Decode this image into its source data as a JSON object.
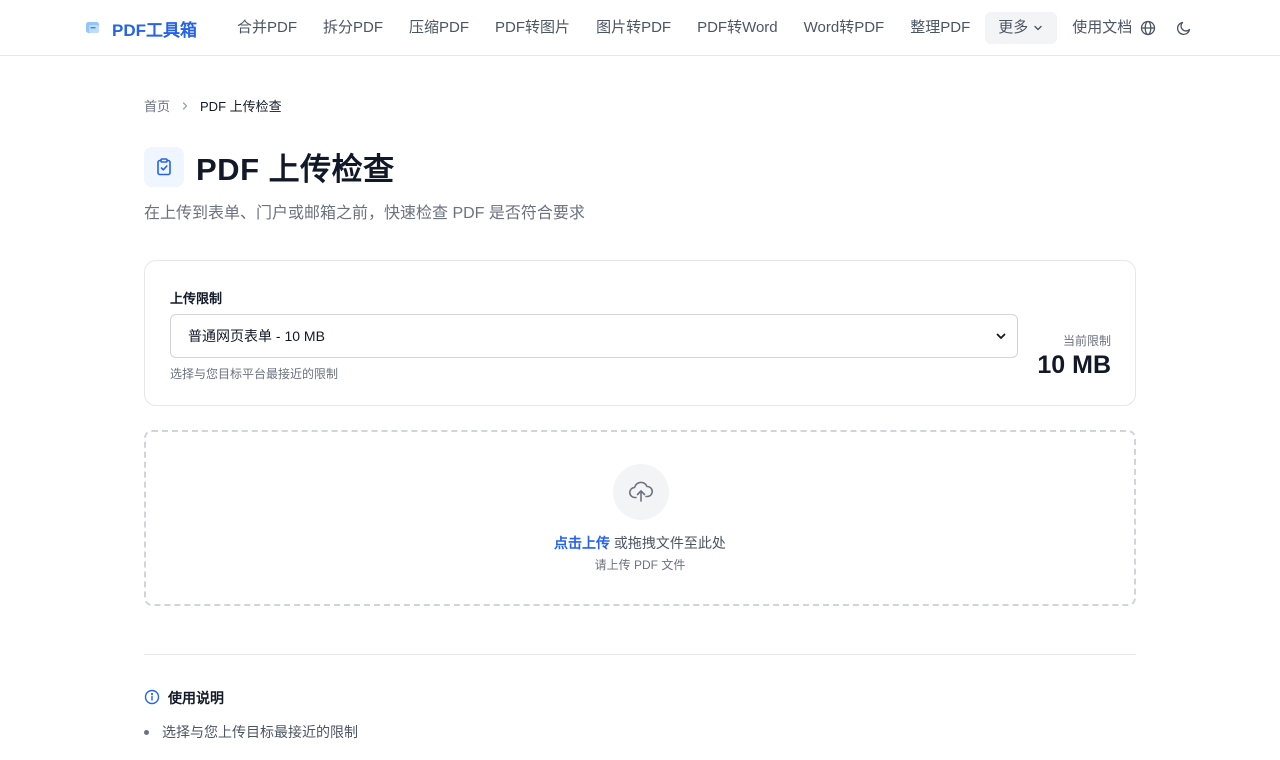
{
  "header": {
    "brand": "PDF工具箱",
    "nav": [
      "合并PDF",
      "拆分PDF",
      "压缩PDF",
      "PDF转图片",
      "图片转PDF",
      "PDF转Word",
      "Word转PDF",
      "整理PDF"
    ],
    "more_label": "更多",
    "docs_label": "使用文档",
    "icons": {
      "language": "globe-icon",
      "theme": "moon-icon"
    }
  },
  "breadcrumb": {
    "home": "首页",
    "current": "PDF 上传检查"
  },
  "page": {
    "title": "PDF 上传检查",
    "subtitle": "在上传到表单、门户或邮箱之前，快速检查 PDF 是否符合要求"
  },
  "limit": {
    "label": "上传限制",
    "selected": "普通网页表单 - 10 MB",
    "hint": "选择与您目标平台最接近的限制",
    "current_label": "当前限制",
    "current_value": "10 MB"
  },
  "upload": {
    "link_text": "点击上传",
    "rest_text": " 或拖拽文件至此处",
    "sub_text": "请上传 PDF 文件"
  },
  "guide": {
    "title": "使用说明",
    "items": [
      "选择与您上传目标最接近的限制"
    ]
  },
  "colors": {
    "accent": "#2563eb",
    "border": "#e5e7eb",
    "muted": "#6b7280"
  }
}
